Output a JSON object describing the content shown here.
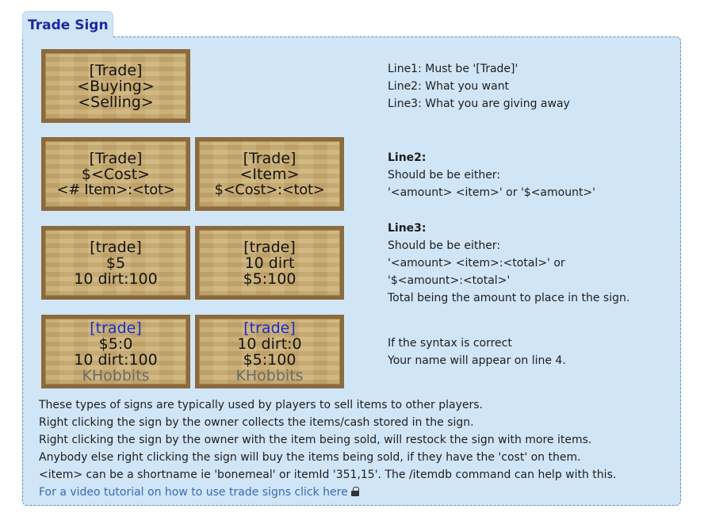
{
  "tab": {
    "title": "Trade Sign"
  },
  "signs": {
    "s1": {
      "l1": "[Trade]",
      "l2": "<Buying>",
      "l3": "<Selling>"
    },
    "s2": {
      "l1": "[Trade]",
      "l2": "$<Cost>",
      "l3": "<# Item>:<tot>"
    },
    "s3": {
      "l1": "[Trade]",
      "l2": "<Item>",
      "l3": "$<Cost>:<tot>"
    },
    "s4": {
      "l1": "[trade]",
      "l2": "$5",
      "l3": "10 dirt:100"
    },
    "s5": {
      "l1": "[trade]",
      "l2": "10 dirt",
      "l3": "$5:100"
    },
    "s6": {
      "l1": "[trade]",
      "l2": "$5:0",
      "l3": "10 dirt:100",
      "l4": "KHobbits"
    },
    "s7": {
      "l1": "[trade]",
      "l2": "10 dirt:0",
      "l3": "$5:100",
      "l4": "KHobbits"
    }
  },
  "desc": {
    "lines": [
      "Line1: Must be '[Trade]'",
      "Line2: What you want",
      "Line3: What you are giving away"
    ],
    "line2": {
      "heading": "Line2:",
      "text1": "Should be be either:",
      "text2": "'<amount> <item>' or '$<amount>'"
    },
    "line3": {
      "heading": "Line3:",
      "text1": "Should be be either:",
      "text2": "'<amount> <item>:<total>' or",
      "text3": "'$<amount>:<total>'",
      "text4": "Total being the amount to place in the sign."
    },
    "syntax": {
      "text1": "If the syntax is correct",
      "text2": "Your name will appear on line 4."
    }
  },
  "paragraph": [
    "These types of signs are typically used by players to sell items to other players.",
    "Right clicking the sign by the owner collects the items/cash stored in the sign.",
    "Right clicking the sign by the owner with the item being sold, will restock the sign with more items.",
    "Anybody else right clicking the sign will buy the items being sold, if they have the 'cost' on them.",
    "<item> can be a shortname ie 'bonemeal' or itemId '351,15'. The /itemdb command can help with this."
  ],
  "link": {
    "text": "For a video tutorial on how to use trade signs click here"
  },
  "icons": {
    "link_icon": "lock-icon"
  }
}
